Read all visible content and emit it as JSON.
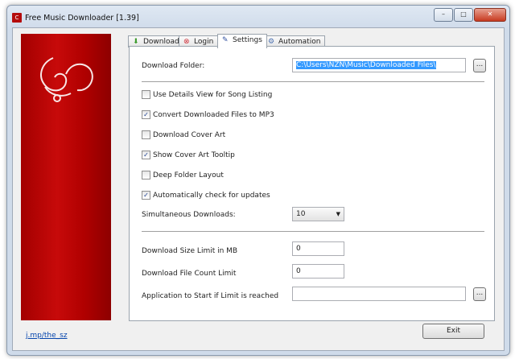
{
  "window": {
    "title": "Free Music Downloader [1.39]",
    "app_icon": "app-logo-icon"
  },
  "tabs": [
    {
      "label": "Download",
      "icon": "download-arrow-icon"
    },
    {
      "label": "Login",
      "icon": "login-icon"
    },
    {
      "label": "Settings",
      "icon": "settings-icon"
    },
    {
      "label": "Automation",
      "icon": "gear-icon"
    }
  ],
  "settings": {
    "download_folder_label": "Download Folder:",
    "download_folder_value": "C:\\Users\\NZN\\Music\\Downloaded Files\\",
    "browse_label": "...",
    "checkboxes": [
      {
        "label": "Use Details View for Song Listing",
        "checked": false
      },
      {
        "label": "Convert Downloaded Files to MP3",
        "checked": true
      },
      {
        "label": "Download Cover Art",
        "checked": false
      },
      {
        "label": "Show Cover Art Tooltip",
        "checked": true
      },
      {
        "label": "Deep Folder Layout",
        "checked": false
      },
      {
        "label": "Automatically check for updates",
        "checked": true
      }
    ],
    "simultaneous_label": "Simultaneous Downloads:",
    "simultaneous_value": "10",
    "size_limit_label": "Download Size Limit in MB",
    "size_limit_value": "0",
    "count_limit_label": "Download File Count Limit",
    "count_limit_value": "0",
    "app_start_label": "Application to Start if Limit is reached",
    "app_start_value": ""
  },
  "footer": {
    "link": "j.mp/the_sz",
    "exit_label": "Exit"
  }
}
